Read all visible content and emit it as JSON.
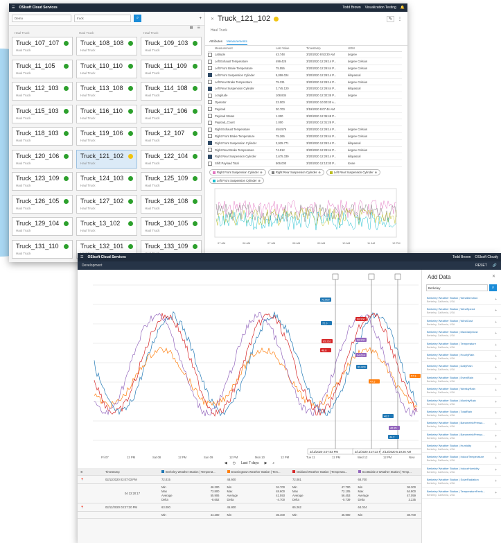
{
  "w1": {
    "app": "OSIsoft Cloud Services",
    "user": "Todd Brown",
    "ns": "Visualization Testing",
    "filter1": "Demo",
    "filter2": "truck",
    "top_types": [
      "Haul Truck",
      "Haul Truck",
      "Haul Truck"
    ],
    "cards": [
      [
        "Truck_107_107",
        "Haul Truck"
      ],
      [
        "Truck_108_108",
        "Haul Truck"
      ],
      [
        "Truck_109_103",
        "Haul Truck"
      ],
      [
        "Truck_11_105",
        "Haul Truck"
      ],
      [
        "Truck_110_110",
        "Haul Truck"
      ],
      [
        "Truck_111_109",
        "Haul Truck"
      ],
      [
        "Truck_112_103",
        "Haul Truck"
      ],
      [
        "Truck_113_108",
        "Haul Truck"
      ],
      [
        "Truck_114_108",
        "Haul Truck"
      ],
      [
        "Truck_115_103",
        "Haul Truck"
      ],
      [
        "Truck_116_110",
        "Haul Truck"
      ],
      [
        "Truck_117_106",
        "Haul Truck"
      ],
      [
        "Truck_118_103",
        "Haul Truck"
      ],
      [
        "Truck_119_106",
        "Haul Truck"
      ],
      [
        "Truck_12_107",
        "Haul Truck"
      ],
      [
        "Truck_120_106",
        "Haul Truck"
      ],
      [
        "Truck_121_102",
        "Haul Truck"
      ],
      [
        "Truck_122_104",
        "Haul Truck"
      ],
      [
        "Truck_123_109",
        "Haul Truck"
      ],
      [
        "Truck_124_103",
        "Haul Truck"
      ],
      [
        "Truck_125_109",
        "Haul Truck"
      ],
      [
        "Truck_126_105",
        "Haul Truck"
      ],
      [
        "Truck_127_102",
        "Haul Truck"
      ],
      [
        "Truck_128_108",
        "Haul Truck"
      ],
      [
        "Truck_129_104",
        "Haul Truck"
      ],
      [
        "Truck_13_102",
        "Haul Truck"
      ],
      [
        "Truck_130_105",
        "Haul Truck"
      ],
      [
        "Truck_131_110",
        "Haul Truck"
      ],
      [
        "Truck_132_101",
        "Haul Truck"
      ],
      [
        "Truck_133_109",
        "Haul Truck"
      ]
    ],
    "detail": {
      "title": "Truck_121_102",
      "type": "Haul Truck",
      "tab1": "Attributes",
      "tab2": "Measurements",
      "cols": [
        "Measurement",
        "Last Value",
        "Timestamp",
        "UOM"
      ],
      "rows": [
        [
          "Latitude",
          "43.748",
          "3/20/2020 9:53:30 AM",
          "degree",
          0
        ],
        [
          "Left Exhaust Temperature",
          "499.425",
          "3/20/2020 12:29:14 P...",
          "degree Celsius",
          0
        ],
        [
          "Left Front Brake Temperature",
          "75.555",
          "3/20/2020 12:29:44 P...",
          "degree Celsius",
          0
        ],
        [
          "Left Front Suspension Cylinder",
          "5,058.024",
          "3/20/2020 12:29:14 P...",
          "kilopascal",
          1
        ],
        [
          "Left Rear Brake Temperature",
          "75.331",
          "3/20/2020 12:29:14 P...",
          "degree Celsius",
          0
        ],
        [
          "Left Rear Suspension Cylinder",
          "2,745.120",
          "3/20/2020 12:29:44 P...",
          "kilopascal",
          1
        ],
        [
          "Longitude",
          "108.834",
          "3/20/2020 12:32:35 P...",
          "degree",
          0
        ],
        [
          "Operator",
          "23.000",
          "3/20/2020 10:00:30 A...",
          "",
          0
        ],
        [
          "Payload",
          "30.700",
          "3/19/2020 9:07:44 AM",
          "",
          0
        ],
        [
          "Payload Status",
          "1.000",
          "3/20/2020 12:35:48 P...",
          "",
          0
        ],
        [
          "Payload_Count",
          "1.000",
          "3/20/2020 12:31:25 P...",
          "",
          0
        ],
        [
          "Right Exhaust Temperature",
          "454.576",
          "3/20/2020 12:29:14 P...",
          "degree Celsius",
          0
        ],
        [
          "Right Front Brake Temperature",
          "75.265",
          "3/20/2020 12:29:44 P...",
          "degree Celsius",
          0
        ],
        [
          "Right Front Suspension Cylinder",
          "2,925.771",
          "3/20/2020 12:29:14 P...",
          "kilopascal",
          1
        ],
        [
          "Right Rear Brake Temperature",
          "74.912",
          "3/20/2020 12:29:44 P...",
          "degree Celsius",
          0
        ],
        [
          "Right Rear Suspension Cylinder",
          "2,675.339",
          "3/20/2020 12:29:14 P...",
          "kilopascal",
          1
        ],
        [
          "Shift Payload Total",
          "506.000",
          "3/20/2020 12:13:30 P...",
          "tonne",
          0
        ]
      ],
      "chips": [
        [
          "Right Front Suspension Cylinder",
          "#e377c2"
        ],
        [
          "Right Rear Suspension Cylinder",
          "#7f7f7f"
        ],
        [
          "Left Rear Suspension Cylinder",
          "#bcbd22"
        ],
        [
          "Left Front Suspension Cylinder",
          "#17becf"
        ]
      ],
      "mini_x": [
        "07 AM",
        "06 AM",
        "07 AM",
        "08 AM",
        "09 AM",
        "10 AM",
        "11 AM",
        "12 PM"
      ]
    }
  },
  "w2": {
    "app": "OSIsoft Cloud Services",
    "user": "Todd Brown",
    "ns": "OSIsoft Cloudy",
    "crumb": "Development",
    "reset": "RESET",
    "x_ticks": [
      "Fri 07",
      "12 PM",
      "Sat 08",
      "12 PM",
      "Sun 09",
      "12 PM",
      "Mon 10",
      "12 PM",
      "Tue 11",
      "12 PM",
      "Wed 12",
      "12 PM",
      "Now"
    ],
    "cursors": [
      "2/11/2020 3:07:03 PM",
      "2/12/2020 3:27:23 PM",
      "2/12/2020 5:19:26 AM"
    ],
    "range": "Last 7 days",
    "tbl_cols": [
      "Timestamp",
      "Berkeley Weather Station | Temperat...",
      "Downingtown Weather Station | Tem...",
      "Oakland Weather Station | Temperatu...",
      "Scottsdale 2 Weather Station | Temp..."
    ],
    "col_colors": [
      "#1f77b4",
      "#ff7f0e",
      "#d62728",
      "#9467bd"
    ],
    "r1": {
      "ts": "02/11/2020 03:07:03 PM",
      "vals": [
        "72.015",
        "48.600",
        "72.081",
        "68.700"
      ],
      "delta": "04 22:20:17",
      "stats": [
        [
          "46.200",
          "73.800",
          "55.906",
          "-8.652"
        ],
        [
          "34.700",
          "48.600",
          "41.593",
          "-4.700"
        ],
        [
          "47.700",
          "72.105",
          "56.453",
          "-0.739"
        ],
        [
          "36.300",
          "64.800",
          "47.059",
          "3.235"
        ]
      ]
    },
    "r2": {
      "ts": "02/12/2020 03:27:20 PM",
      "vals": [
        "63.000",
        "45.800",
        "65.262",
        "64.024"
      ],
      "stats": [
        "44.200",
        "35.400",
        "45.900",
        "38.700"
      ]
    },
    "stat_labels": [
      "Min",
      "Max",
      "Average",
      "Delta"
    ],
    "add": {
      "title": "Add Data",
      "search": "Berkeley",
      "items": [
        [
          "Berkeley Weather Station | WindDirection",
          "Berkeley, California, USA"
        ],
        [
          "Berkeley Weather Station | WindSpeed",
          "Berkeley, California, USA"
        ],
        [
          "Berkeley Weather Station | WindGust",
          "Berkeley, California, USA"
        ],
        [
          "Berkeley Weather Station | MaxDailyGust",
          "Berkeley, California, USA"
        ],
        [
          "Berkeley Weather Station | Temperature",
          "Berkeley, California, USA"
        ],
        [
          "Berkeley Weather Station | HourlyRain",
          "Berkeley, California, USA"
        ],
        [
          "Berkeley Weather Station | DailyRain",
          "Berkeley, California, USA"
        ],
        [
          "Berkeley Weather Station | EventRain",
          "Berkeley, California, USA"
        ],
        [
          "Berkeley Weather Station | WeeklyRain",
          "Berkeley, California, USA"
        ],
        [
          "Berkeley Weather Station | MonthlyRain",
          "Berkeley, California, USA"
        ],
        [
          "Berkeley Weather Station | TotalRain",
          "Berkeley, California, USA"
        ],
        [
          "Berkeley Weather Station | BarometricPressu...",
          "Berkeley, California, USA"
        ],
        [
          "Berkeley Weather Station | BarometricPressu...",
          "Berkeley, California, USA"
        ],
        [
          "Berkeley Weather Station | Humidity",
          "Berkeley, California, USA"
        ],
        [
          "Berkeley Weather Station | IndoorTemperature",
          "Berkeley, California, USA"
        ],
        [
          "Berkeley Weather Station | IndoorHumidity",
          "Berkeley, California, USA"
        ],
        [
          "Berkeley Weather Station | SolarRadiation",
          "Berkeley, California, USA"
        ],
        [
          "Berkeley Weather Station | TemperatureFeels...",
          "Berkeley, California, USA"
        ]
      ]
    },
    "tags": [
      [
        "73.800",
        "#1f77b4"
      ],
      [
        "72.0",
        "#1f77b4"
      ],
      [
        "68.900",
        "#d62728"
      ],
      [
        "68.900",
        "#9467bd"
      ],
      [
        "64.624",
        "#9467bd"
      ],
      [
        "63.000",
        "#1f77b4"
      ],
      [
        "57.3",
        "#ff7f0e"
      ],
      [
        "65.262",
        "#d62728"
      ],
      [
        "48.6",
        "#d62728"
      ],
      [
        "47.5",
        "#ff7f0e"
      ],
      [
        "46.2",
        "#1f77b4"
      ],
      [
        "46.95",
        "#9467bd"
      ],
      [
        "44.2",
        "#1f77b4"
      ]
    ]
  }
}
